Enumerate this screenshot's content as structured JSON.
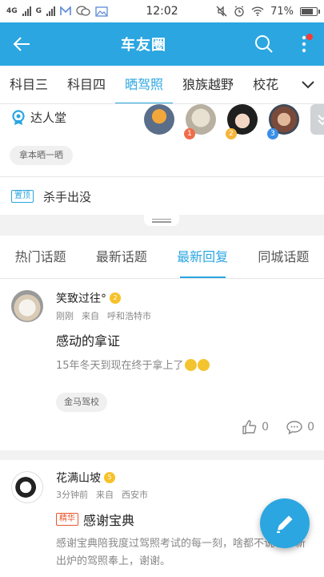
{
  "status_bar": {
    "network": "4G",
    "carrier2": "G",
    "time": "12:02",
    "battery": "71%"
  },
  "app_bar": {
    "title": "车友圈",
    "icons": [
      "back-arrow-icon",
      "search-icon",
      "more-vertical-icon"
    ],
    "accent_color": "#2ba6e1",
    "badge_color": "#ff3b30"
  },
  "category_tabs": {
    "items": [
      "科目三",
      "科目四",
      "晒驾照",
      "狼族越野",
      "校花"
    ],
    "active": "晒驾照"
  },
  "hall": {
    "label": "达人堂",
    "chip": "拿本晒一晒",
    "ranks": [
      "1",
      "2",
      "3"
    ]
  },
  "pinned": {
    "badge": "置顶",
    "text": "杀手出没"
  },
  "topic_tabs": {
    "items": [
      "热门话题",
      "最新话题",
      "最新回复",
      "同城话题"
    ],
    "active": "最新回复"
  },
  "posts": [
    {
      "name": "笑致过往°",
      "level": "2",
      "time": "刚刚",
      "from": "来自",
      "city": "呼和浩特市",
      "title": "感动的拿证",
      "body": "15年冬天到现在终于拿上了",
      "tag": "金马驾校",
      "likes": "0",
      "comments": "0"
    },
    {
      "name": "花满山坡",
      "level": "5",
      "time": "3分钟前",
      "from": "来自",
      "city": "西安市",
      "badge": "精华",
      "title": "感谢宝典",
      "body": "感谢宝典陪我度过驾照考试的每一刻，啥都不说了，新出炉的驾照奉上，谢谢。"
    }
  ]
}
